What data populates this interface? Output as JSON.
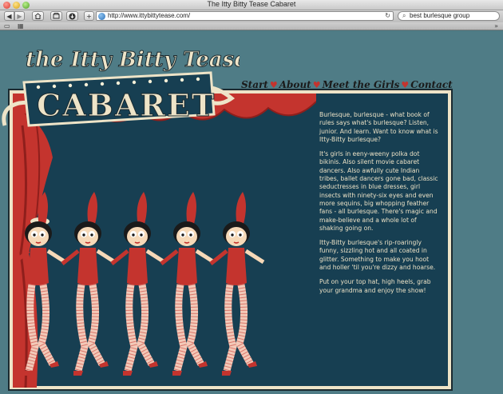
{
  "browser": {
    "title": "The Itty Bitty Tease Cabaret",
    "url": "http://www.ittybittytease.com/",
    "search_query": "best burlesque group",
    "icons": {
      "back": "back-icon",
      "forward": "forward-icon",
      "home": "home-icon",
      "box": "box-icon",
      "download": "download-icon",
      "add": "add-bookmark-icon",
      "reload": "reload-icon",
      "search": "search-icon",
      "bookmarks": "bookmarks-book-icon",
      "grid": "top-sites-grid-icon",
      "more": "chevron-more-icon"
    }
  },
  "site": {
    "logo": {
      "line1": "the Itty Bitty Tease",
      "line2": "CABARET"
    },
    "nav": [
      "Start",
      "About",
      "Meet the Girls",
      "Contact"
    ],
    "paragraphs": [
      "Burlesque, burlesque - what book of rules says what's burlesque? Listen, junior. And learn. Want to know what is Itty-Bitty burlesque?",
      "It's girls in eeny-weeny polka dot bikinis. Also silent movie cabaret dancers. Also awfully cute Indian tribes, ballet dancers gone bad, classic seductresses in blue dresses, girl insects with ninety-six eyes and even more sequins, big whopping feather fans - all burlesque. There's magic and make-believe and a whole lot of shaking going on.",
      "Itty-Bitty burlesque's rip-roaringly funny, sizzling hot and all coated in glitter. Something to make you hoot and holler 'til you're dizzy and hoarse.",
      "Put on your top hat, high heels, grab your grandma and enjoy the show!"
    ],
    "colors": {
      "background": "#4f7c86",
      "stage": "#173f52",
      "cream": "#eee4c8",
      "curtain_red": "#c4342e",
      "nav_text": "#1a1a1a"
    }
  }
}
